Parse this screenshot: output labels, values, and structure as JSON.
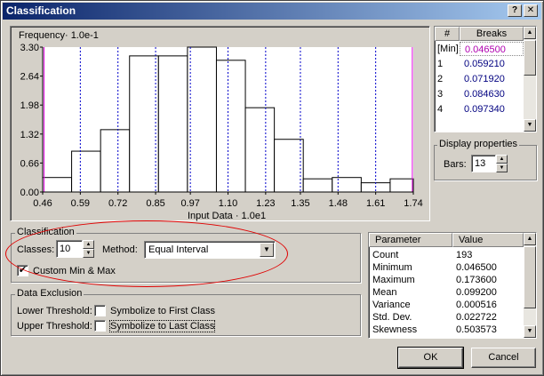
{
  "window": {
    "title": "Classification",
    "help_glyph": "?",
    "close_glyph": "✕"
  },
  "chart_data": {
    "type": "bar",
    "title": "",
    "ylabel": "Frequency· 1.0e-1",
    "xlabel": "Input Data · 1.0e1",
    "x_ticks": [
      "0.46",
      "0.59",
      "0.72",
      "0.85",
      "0.97",
      "1.10",
      "1.23",
      "1.35",
      "1.48",
      "1.61",
      "1.74"
    ],
    "y_ticks": [
      "0.00",
      "0.66",
      "1.32",
      "1.98",
      "2.64",
      "3.30"
    ],
    "ylim": [
      0,
      3.3
    ],
    "xlim": [
      0.46,
      1.74
    ],
    "bins": [
      {
        "x0": 0.46,
        "x1": 0.56,
        "value": 0.33
      },
      {
        "x0": 0.56,
        "x1": 0.66,
        "value": 0.93
      },
      {
        "x0": 0.66,
        "x1": 0.76,
        "value": 1.42
      },
      {
        "x0": 0.76,
        "x1": 0.86,
        "value": 3.1
      },
      {
        "x0": 0.86,
        "x1": 0.96,
        "value": 3.1
      },
      {
        "x0": 0.96,
        "x1": 1.06,
        "value": 3.3
      },
      {
        "x0": 1.06,
        "x1": 1.16,
        "value": 3.0
      },
      {
        "x0": 1.16,
        "x1": 1.26,
        "value": 1.92
      },
      {
        "x0": 1.26,
        "x1": 1.36,
        "value": 1.2
      },
      {
        "x0": 1.36,
        "x1": 1.46,
        "value": 0.3
      },
      {
        "x0": 1.46,
        "x1": 1.56,
        "value": 0.33
      },
      {
        "x0": 1.56,
        "x1": 1.66,
        "value": 0.21
      },
      {
        "x0": 1.66,
        "x1": 1.74,
        "value": 0.3
      }
    ],
    "break_lines": [
      0.59,
      0.72,
      0.85,
      0.97,
      1.1,
      1.23,
      1.35,
      1.48,
      1.61
    ],
    "boundary_lines": [
      0.465,
      1.7365
    ],
    "colors": {
      "bar_fill": "#ffffff",
      "bar_stroke": "#000000",
      "break_line": "#0000cc",
      "boundary_line": "#e000e0"
    }
  },
  "breaks": {
    "headers": [
      "#",
      "Breaks"
    ],
    "rows": [
      {
        "index": "[Min]",
        "value": "0.046500"
      },
      {
        "index": "1",
        "value": "0.059210"
      },
      {
        "index": "2",
        "value": "0.071920"
      },
      {
        "index": "3",
        "value": "0.084630"
      },
      {
        "index": "4",
        "value": "0.097340"
      }
    ]
  },
  "display": {
    "group_title": "Display properties",
    "bars_label": "Bars:",
    "bars_value": "13"
  },
  "classification": {
    "group_title": "Classification",
    "classes_label": "Classes:",
    "classes_value": "10",
    "method_label": "Method:",
    "method_value": "Equal Interval",
    "custom_minmax_label": "Custom Min & Max",
    "custom_minmax_checked": "✔"
  },
  "exclusion": {
    "group_title": "Data Exclusion",
    "lower_label": "Lower Threshold:",
    "upper_label": "Upper Threshold:",
    "first_class_label": "Symbolize to First Class",
    "last_class_label": "Symbolize to Last Class"
  },
  "parameters": {
    "headers": [
      "Parameter",
      "Value"
    ],
    "rows": [
      {
        "name": "Count",
        "value": "193"
      },
      {
        "name": "Minimum",
        "value": "0.046500"
      },
      {
        "name": "Maximum",
        "value": "0.173600"
      },
      {
        "name": "Mean",
        "value": "0.099200"
      },
      {
        "name": "Variance",
        "value": "0.000516"
      },
      {
        "name": "Std. Dev.",
        "value": "0.022722"
      },
      {
        "name": "Skewness",
        "value": "0.503573"
      }
    ]
  },
  "buttons": {
    "ok": "OK",
    "cancel": "Cancel"
  }
}
